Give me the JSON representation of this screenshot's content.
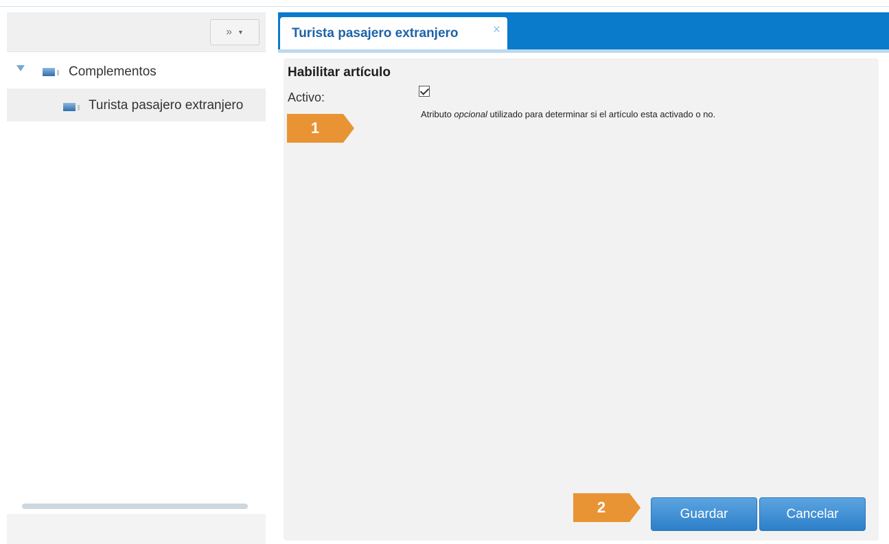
{
  "toolbar": {
    "expand_glyph": "»",
    "caret_glyph": "▼"
  },
  "tree": {
    "root": {
      "label": "Complementos",
      "icon": "module-icon"
    },
    "child": {
      "label": "Turista pasajero extranjero",
      "icon": "module-icon"
    }
  },
  "tabs": [
    {
      "label": "Turista pasajero extranjero",
      "close": "×"
    }
  ],
  "form": {
    "section_title": "Habilitar artículo",
    "field_label": "Activo:",
    "checked": true,
    "help_pre": "Atributo ",
    "help_em": "opcional",
    "help_post": " utilizado para determinar si el artículo esta activado o no."
  },
  "callouts": {
    "one": "1",
    "two": "2"
  },
  "buttons": {
    "save": "Guardar",
    "cancel": "Cancelar"
  },
  "colors": {
    "accent": "#0a7acb",
    "callout": "#e99434",
    "button": "#3d8fd6"
  }
}
